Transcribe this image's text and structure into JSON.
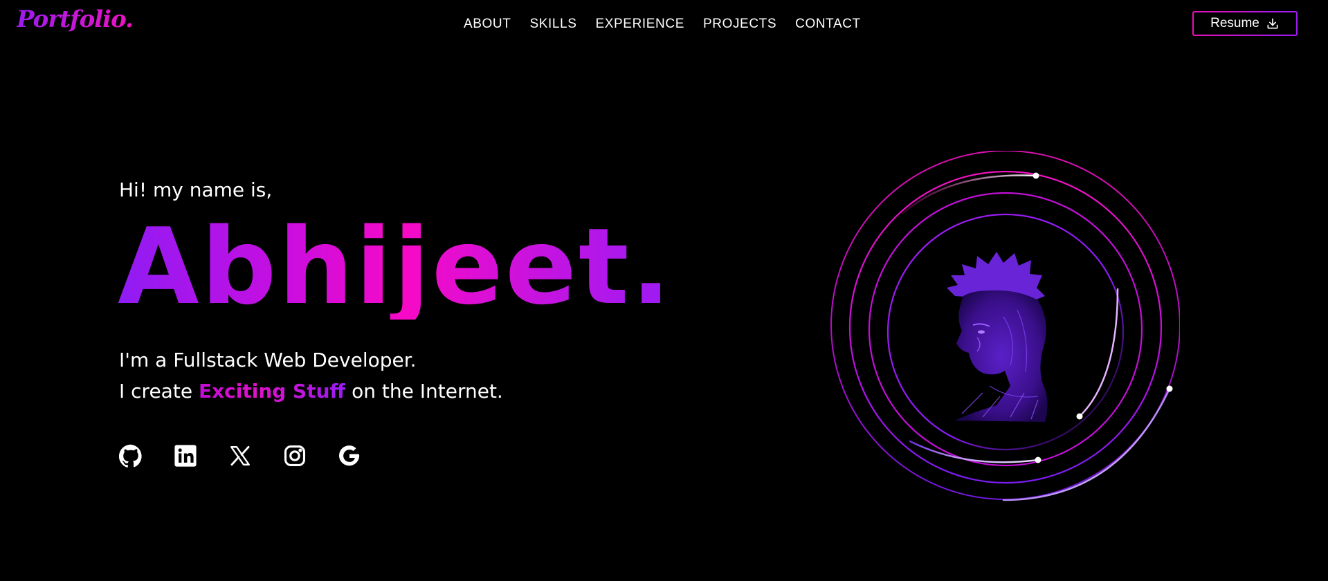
{
  "nav": {
    "logo": "Portfolio.",
    "links": [
      "ABOUT",
      "SKILLS",
      "EXPERIENCE",
      "PROJECTS",
      "CONTACT"
    ],
    "resume_label": "Resume"
  },
  "hero": {
    "greeting": "Hi! my name is,",
    "name": "Abhijeet.",
    "line1": "I'm a Fullstack Web Developer.",
    "line2_prefix": "I create ",
    "line2_highlight": "Exciting Stuff",
    "line2_suffix": " on the Internet."
  },
  "socials": [
    {
      "icon": "github-icon"
    },
    {
      "icon": "linkedin-icon"
    },
    {
      "icon": "x-icon"
    },
    {
      "icon": "instagram-icon"
    },
    {
      "icon": "google-icon"
    }
  ],
  "colors": {
    "background": "#000000",
    "accent_pink": "#f70ac6",
    "accent_purple": "#8f1cf4",
    "text": "#ffffff"
  }
}
